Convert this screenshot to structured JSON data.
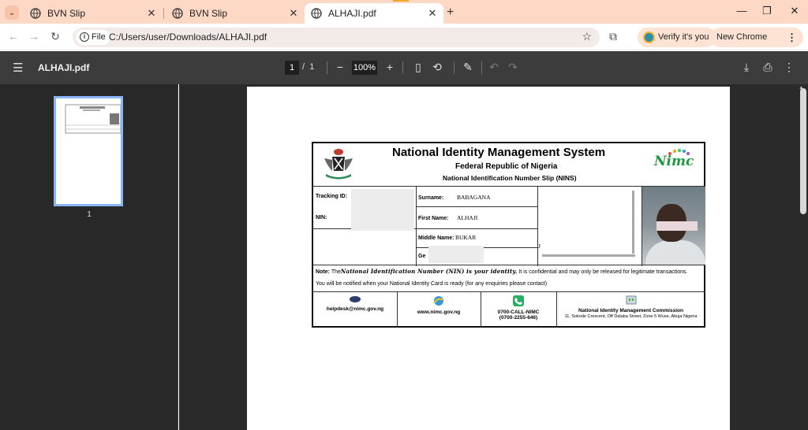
{
  "browser": {
    "tabs": [
      {
        "title": "BVN Slip",
        "active": false
      },
      {
        "title": "BVN Slip",
        "active": false
      },
      {
        "title": "ALHAJI.pdf",
        "active": true
      }
    ],
    "address": {
      "chip_label": "File",
      "url": "C:/Users/user/Downloads/ALHAJI.pdf"
    },
    "verify_label": "Verify it's you",
    "update_label": "New Chrome available"
  },
  "pdf_toolbar": {
    "file_name": "ALHAJI.pdf",
    "current_page": "1",
    "page_sep": "/",
    "total_pages": "1",
    "zoom": "100%"
  },
  "sidebar": {
    "thumbnail_label": "1"
  },
  "slip": {
    "title": "National Identity Management System",
    "subtitle": "Federal Republic of Nigeria",
    "slip_name": "National Identification Number Slip (NINS)",
    "logo_text": "Nimc",
    "labels": {
      "tracking_id": "Tracking ID:",
      "nin": "NIN:",
      "surname": "Surname:",
      "first_name": "First Name:",
      "middle_name": "Middle Name:",
      "gender": "Ge"
    },
    "values": {
      "surname": "BABAGANA",
      "first_name": "ALHAJI",
      "middle_name": "BUKAR"
    },
    "address_mark": "J",
    "note_label": "Note:",
    "note_the": "The",
    "note_emphasis": "National Identification Number (NIN) is your identity.",
    "note_rest": " It is confidential and may only be released for legitimate transactions.",
    "notice": "You will be notified when your National Identity Card is ready   (for any enquiries please contact)",
    "footer": {
      "email": "helpdesk@nimc.gov.ng",
      "website": "www.nimc.gov.ng",
      "phone1": "0700-CALL-NIMC",
      "phone2": "(0700-2255-646)",
      "org": "National Identity Management Commission",
      "address": "11, Sokode Crescent, Off Dalaba Street, Zone 5 Wuse, Abuja Nigeria"
    }
  },
  "colors": {
    "tab_strip": "#fdd8c4",
    "pdf_toolbar": "#3c3c3c",
    "viewer_bg": "#2a2a2a",
    "nimc_green": "#1f9a3f"
  }
}
